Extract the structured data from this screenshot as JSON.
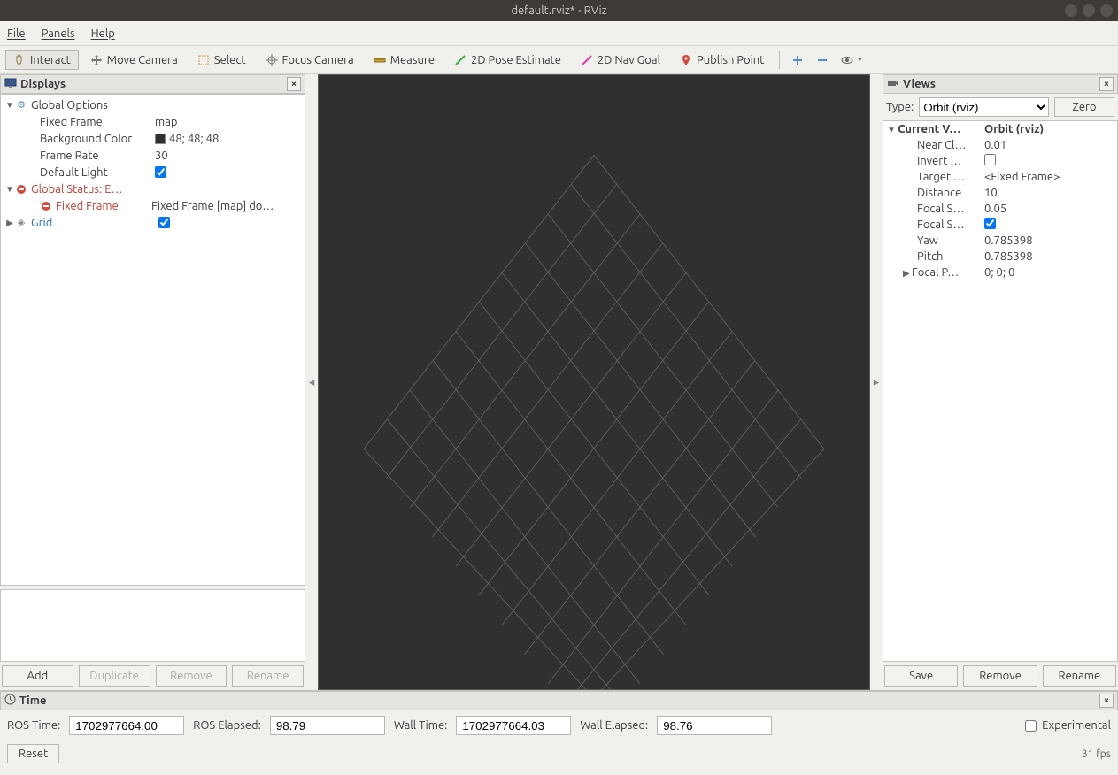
{
  "window": {
    "title": "default.rviz* - RViz"
  },
  "menu": {
    "file": "File",
    "panels": "Panels",
    "help": "Help"
  },
  "toolbar": {
    "interact": "Interact",
    "move_camera": "Move Camera",
    "select": "Select",
    "focus_camera": "Focus Camera",
    "measure": "Measure",
    "pose_estimate": "2D Pose Estimate",
    "nav_goal": "2D Nav Goal",
    "publish_point": "Publish Point"
  },
  "displays": {
    "title": "Displays",
    "global_options": "Global Options",
    "fixed_frame_label": "Fixed Frame",
    "fixed_frame_value": "map",
    "background_color_label": "Background Color",
    "background_color_value": "48; 48; 48",
    "frame_rate_label": "Frame Rate",
    "frame_rate_value": "30",
    "default_light_label": "Default Light",
    "global_status_label": "Global Status: E…",
    "fixed_frame_err_label": "Fixed Frame",
    "fixed_frame_err_value": "Fixed Frame [map] do…",
    "grid_label": "Grid",
    "buttons": {
      "add": "Add",
      "duplicate": "Duplicate",
      "remove": "Remove",
      "rename": "Rename"
    }
  },
  "views": {
    "title": "Views",
    "type_label": "Type:",
    "type_value": "Orbit (rviz)",
    "zero": "Zero",
    "current_view_label": "Current V…",
    "current_view_value": "Orbit (rviz)",
    "near_clip_label": "Near Cl…",
    "near_clip_value": "0.01",
    "invert_label": "Invert …",
    "target_label": "Target …",
    "target_value": "<Fixed Frame>",
    "distance_label": "Distance",
    "distance_value": "10",
    "focal_shape_size_label": "Focal S…",
    "focal_shape_size_value": "0.05",
    "focal_shape_fixed_label": "Focal S…",
    "yaw_label": "Yaw",
    "yaw_value": "0.785398",
    "pitch_label": "Pitch",
    "pitch_value": "0.785398",
    "focal_point_label": "Focal P…",
    "focal_point_value": "0; 0; 0",
    "buttons": {
      "save": "Save",
      "remove": "Remove",
      "rename": "Rename"
    }
  },
  "time": {
    "title": "Time",
    "ros_time_label": "ROS Time:",
    "ros_time_value": "1702977664.00",
    "ros_elapsed_label": "ROS Elapsed:",
    "ros_elapsed_value": "98.79",
    "wall_time_label": "Wall Time:",
    "wall_time_value": "1702977664.03",
    "wall_elapsed_label": "Wall Elapsed:",
    "wall_elapsed_value": "98.76",
    "experimental": "Experimental",
    "reset": "Reset",
    "fps": "31 fps"
  }
}
